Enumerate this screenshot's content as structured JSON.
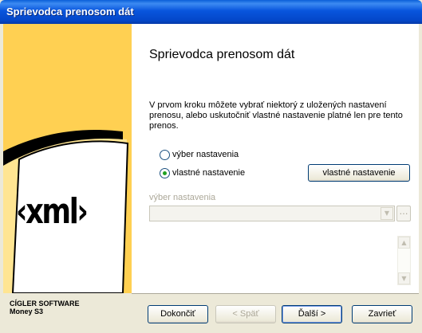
{
  "window": {
    "title": "Sprievodca prenosom dát"
  },
  "brand": {
    "line1": "CÍGLER SOFTWARE",
    "line2": "Money S3"
  },
  "sidebar": {
    "logo_text": "‹xml›"
  },
  "main": {
    "heading": "Sprievodca prenosom dát",
    "description": "V prvom kroku môžete vybrať niektorý z uložených nastavení prenosu, alebo uskutočniť vlastné nastavenie platné len pre tento prenos.",
    "radio_preset_label": "výber nastavenia",
    "radio_custom_label": "vlastné nastavenie",
    "custom_button_label": "vlastné nastavenie",
    "field_label": "výber nastavenia",
    "combo_value": "",
    "dots_label": "…"
  },
  "footer": {
    "finish": "Dokončiť",
    "back": "< Späť",
    "next": "Ďalší >",
    "close": "Zavrieť"
  },
  "state": {
    "selected_radio": "custom"
  },
  "colors": {
    "sidebar": "#ffd052",
    "titlebar": "#0855dd",
    "radio_dot": "#21a121"
  }
}
